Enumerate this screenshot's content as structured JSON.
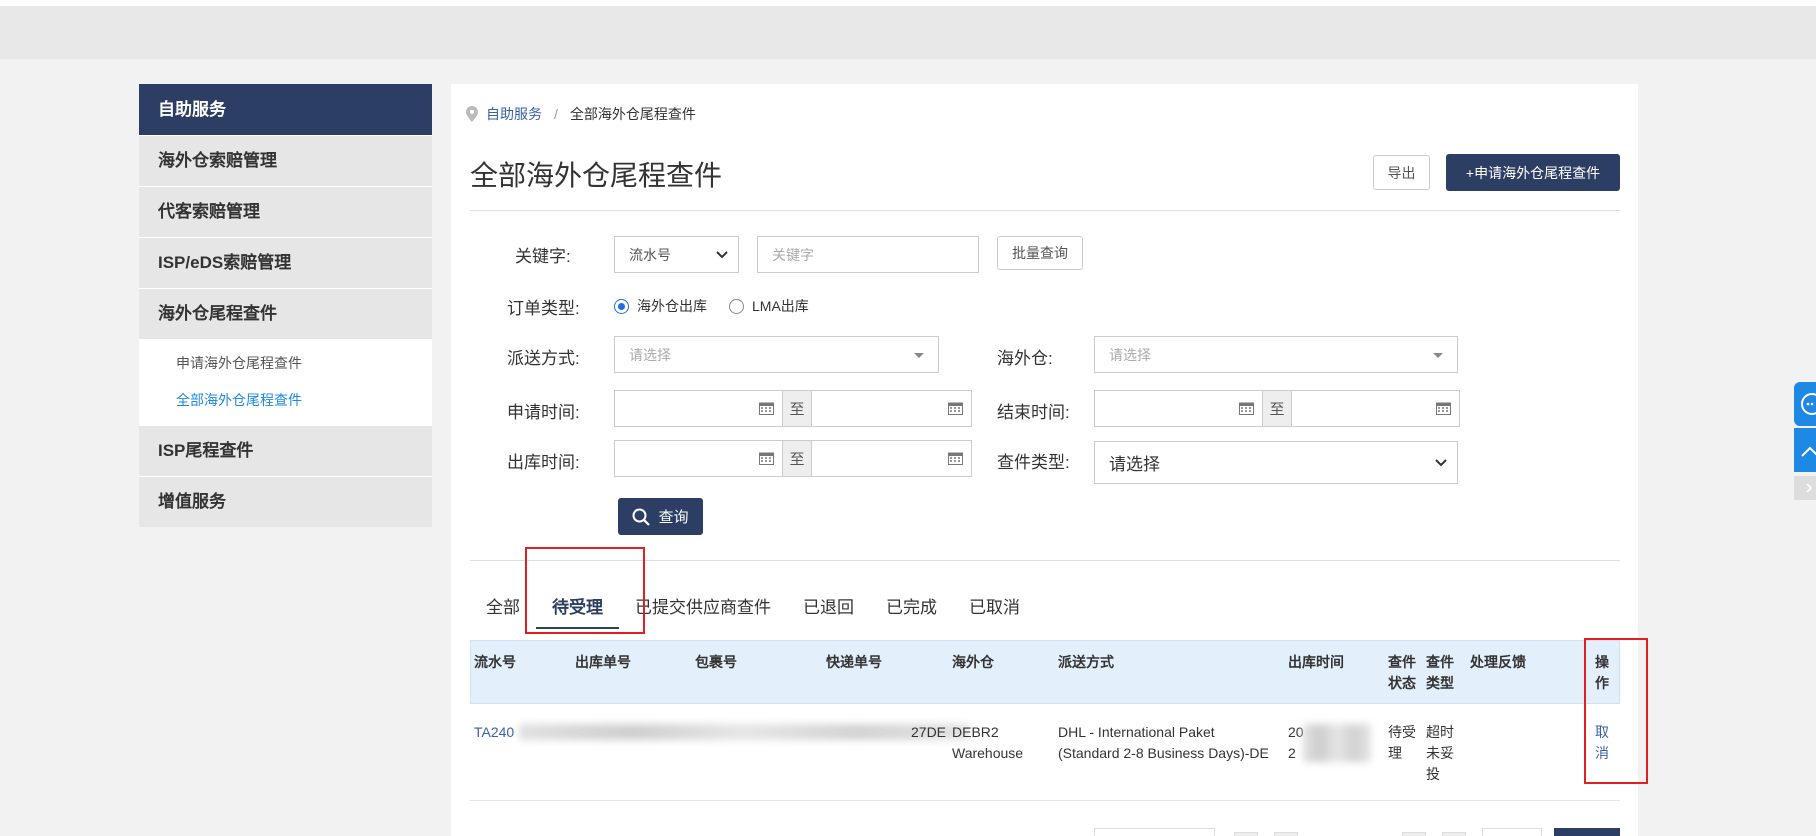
{
  "sidebar": {
    "header": "自助服务",
    "items": [
      {
        "label": "海外仓索赔管理"
      },
      {
        "label": "代客索赔管理"
      },
      {
        "label": "ISP/eDS索赔管理"
      },
      {
        "label": "海外仓尾程查件"
      }
    ],
    "subitems": [
      {
        "label": "申请海外仓尾程查件"
      },
      {
        "label": "全部海外仓尾程查件"
      }
    ],
    "items_after": [
      {
        "label": "ISP尾程查件"
      },
      {
        "label": "增值服务"
      }
    ]
  },
  "breadcrumb": {
    "root": "自助服务",
    "sep": "/",
    "current": "全部海外仓尾程查件"
  },
  "page": {
    "title": "全部海外仓尾程查件",
    "export_label": "导出",
    "apply_label": "+申请海外仓尾程查件"
  },
  "filters": {
    "keyword_label": "关键字:",
    "keyword_type": "流水号",
    "keyword_placeholder": "关键字",
    "batch_label": "批量查询",
    "order_type_label": "订单类型:",
    "order_type_options": [
      "海外仓出库",
      "LMA出库"
    ],
    "delivery_label": "派送方式:",
    "delivery_placeholder": "请选择",
    "warehouse_label": "海外仓:",
    "warehouse_placeholder": "请选择",
    "apply_time_label": "申请时间:",
    "end_time_label": "结束时间:",
    "outbound_time_label": "出库时间:",
    "query_type_label": "查件类型:",
    "query_type_value": "请选择",
    "to": "至",
    "search_label": "查询"
  },
  "tabs": [
    {
      "label": "全部"
    },
    {
      "label": "待受理"
    },
    {
      "label": "已提交供应商查件"
    },
    {
      "label": "已退回"
    },
    {
      "label": "已完成"
    },
    {
      "label": "已取消"
    }
  ],
  "active_tab": "待受理",
  "table": {
    "headers": [
      "流水号",
      "出库单号",
      "包裹号",
      "快递单号",
      "海外仓",
      "派送方式",
      "出库时间",
      "查件状态",
      "查件类型",
      "处理反馈",
      "操作"
    ],
    "rows": [
      {
        "serial": "TA240",
        "tracking_tail": "27DE",
        "warehouse": "DEBR2 Warehouse",
        "delivery": "DHL - International Paket (Standard 2-8 Business Days)-DE",
        "outbound_time_a": "20",
        "outbound_time_b": "2",
        "status": "待受理",
        "query_type": "超时未妥投",
        "action": "取消"
      }
    ]
  },
  "colors": {
    "navy": "#2c3e64",
    "link": "#3a5fa8",
    "active_sub": "#1e88e5",
    "highlight": "#e02020",
    "table_head": "#e3effb"
  }
}
